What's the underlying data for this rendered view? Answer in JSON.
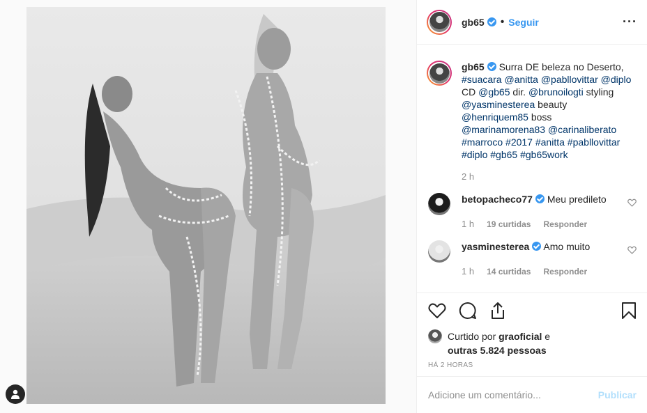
{
  "post": {
    "username": "gb65",
    "follow_label": "Seguir",
    "more_icon": "more-horizontal-icon",
    "verified_icon": "verified-badge-icon"
  },
  "caption": {
    "username": "gb65",
    "segments": [
      {
        "text": "Surra DE beleza no Deserto, ",
        "link": false
      },
      {
        "text": "#suacara",
        "link": true
      },
      {
        "text": " ",
        "link": false
      },
      {
        "text": "@anitta",
        "link": true
      },
      {
        "text": " ",
        "link": false
      },
      {
        "text": "@pabllovittar",
        "link": true
      },
      {
        "text": " ",
        "link": false
      },
      {
        "text": "@diplo",
        "link": true
      },
      {
        "text": " CD ",
        "link": false
      },
      {
        "text": "@gb65",
        "link": true
      },
      {
        "text": " dir. ",
        "link": false
      },
      {
        "text": "@brunoilogti",
        "link": true
      },
      {
        "text": " styling ",
        "link": false
      },
      {
        "text": "@yasminesterea",
        "link": true
      },
      {
        "text": " beauty ",
        "link": false
      },
      {
        "text": "@henriquem85",
        "link": true
      },
      {
        "text": " boss ",
        "link": false
      },
      {
        "text": "@marinamorena83",
        "link": true
      },
      {
        "text": " ",
        "link": false
      },
      {
        "text": "@carinaliberato",
        "link": true
      },
      {
        "text": " ",
        "link": false
      },
      {
        "text": "#marroco",
        "link": true
      },
      {
        "text": " ",
        "link": false
      },
      {
        "text": "#2017",
        "link": true
      },
      {
        "text": " ",
        "link": false
      },
      {
        "text": "#anitta",
        "link": true
      },
      {
        "text": " ",
        "link": false
      },
      {
        "text": "#pabllovittar",
        "link": true
      },
      {
        "text": " ",
        "link": false
      },
      {
        "text": "#diplo",
        "link": true
      },
      {
        "text": " ",
        "link": false
      },
      {
        "text": "#gb65",
        "link": true
      },
      {
        "text": " ",
        "link": false
      },
      {
        "text": "#gb65work",
        "link": true
      }
    ],
    "time": "2 h"
  },
  "comments": [
    {
      "username": "betopacheco77",
      "text": "Meu predileto",
      "time": "1 h",
      "likes": "19 curtidas",
      "reply": "Responder",
      "avatar_color": "#1c1c1c"
    },
    {
      "username": "yasminesterea",
      "text": "Amo muito",
      "time": "1 h",
      "likes": "14 curtidas",
      "reply": "Responder",
      "avatar_color": "#e3e3e3"
    }
  ],
  "actions": {
    "icons": [
      "heart-icon",
      "comment-icon",
      "share-icon",
      "bookmark-icon"
    ]
  },
  "likes": {
    "prefix": "Curtido por ",
    "user": "graoficial",
    "mid": " e",
    "others": "outras 5.824 pessoas"
  },
  "timestamp": "HÁ 2 HORAS",
  "add_comment": {
    "placeholder": "Adicione um comentário...",
    "publish": "Publicar"
  }
}
